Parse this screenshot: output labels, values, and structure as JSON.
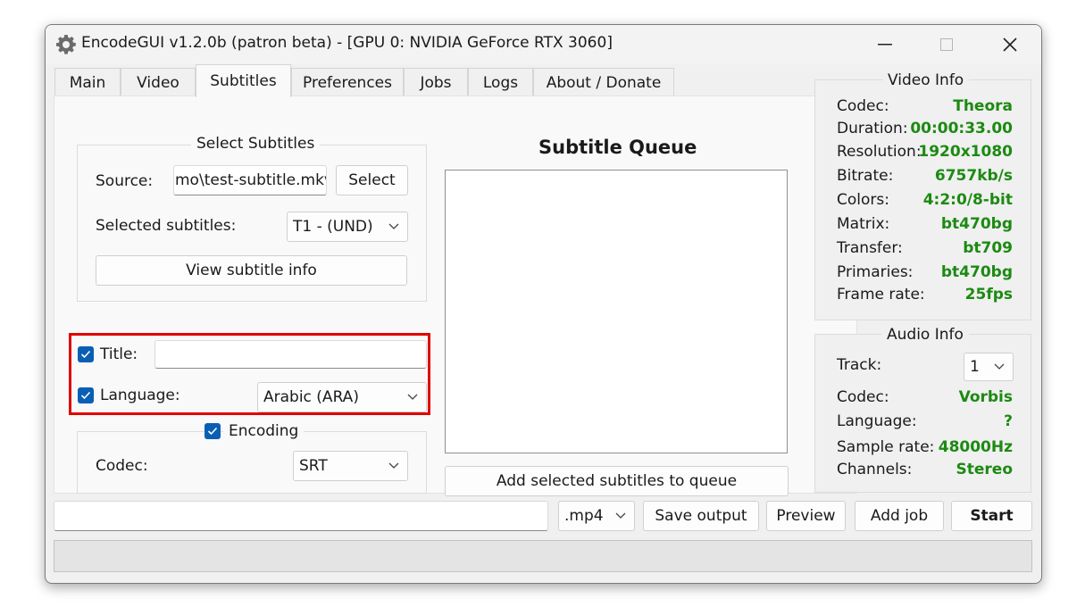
{
  "window": {
    "title": "EncodeGUI v1.2.0b (patron beta) - [GPU 0: NVIDIA GeForce RTX 3060]",
    "app_icon": "gear-icon"
  },
  "tabs": [
    {
      "label": "Main"
    },
    {
      "label": "Video"
    },
    {
      "label": "Subtitles",
      "active": true
    },
    {
      "label": "Preferences"
    },
    {
      "label": "Jobs"
    },
    {
      "label": "Logs"
    },
    {
      "label": "About / Donate"
    }
  ],
  "select_subtitles": {
    "title": "Select Subtitles",
    "source_label": "Source:",
    "source_value": "mo\\test-subtitle.mkv",
    "select_button": "Select",
    "selected_label": "Selected subtitles:",
    "selected_value": "T1 - (UND)",
    "view_info_button": "View subtitle info"
  },
  "metadata": {
    "title_label": "Title:",
    "title_checked": true,
    "title_value": "",
    "language_label": "Language:",
    "language_checked": true,
    "language_value": "Arabic (ARA)"
  },
  "encoding": {
    "label": "Encoding",
    "checked": true,
    "codec_label": "Codec:",
    "codec_value": "SRT"
  },
  "queue": {
    "title": "Subtitle Queue",
    "items": [],
    "add_button": "Add selected subtitles to queue"
  },
  "video_info": {
    "title": "Video Info",
    "rows": [
      {
        "key": "Codec:",
        "value": "Theora"
      },
      {
        "key": "Duration:",
        "value": "00:00:33.00"
      },
      {
        "key": "Resolution:",
        "value": "1920x1080"
      },
      {
        "key": "Bitrate:",
        "value": "6757kb/s"
      },
      {
        "key": "Colors:",
        "value": "4:2:0/8-bit"
      },
      {
        "key": "Matrix:",
        "value": "bt470bg"
      },
      {
        "key": "Transfer:",
        "value": "bt709"
      },
      {
        "key": "Primaries:",
        "value": "bt470bg"
      },
      {
        "key": "Frame rate:",
        "value": "25fps"
      }
    ]
  },
  "audio_info": {
    "title": "Audio Info",
    "track_label": "Track:",
    "track_value": "1",
    "rows": [
      {
        "key": "Codec:",
        "value": "Vorbis"
      },
      {
        "key": "Language:",
        "value": "?"
      },
      {
        "key": "Sample rate:",
        "value": "48000Hz"
      },
      {
        "key": "Channels:",
        "value": "Stereo"
      }
    ]
  },
  "bottom": {
    "output_path": "",
    "container": ".mp4",
    "save_output": "Save output",
    "preview": "Preview",
    "add_job": "Add job",
    "start": "Start",
    "progress": 0
  },
  "colors": {
    "value_green": "#1c8a12",
    "checkbox_blue": "#0a5fb4",
    "highlight_red": "#e00000"
  }
}
